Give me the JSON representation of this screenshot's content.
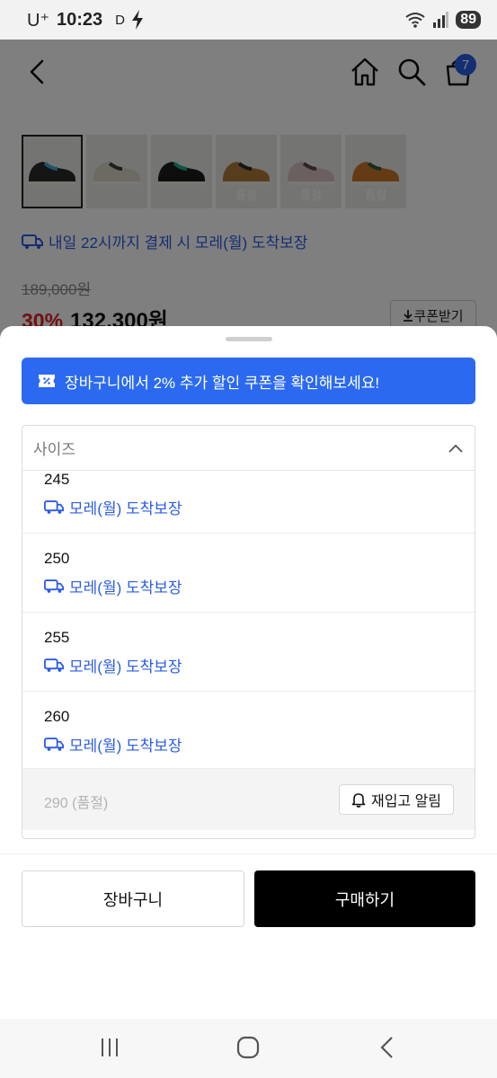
{
  "status_bar": {
    "carrier": "U⁺",
    "time": "10:23",
    "indicator": "D",
    "battery": "89"
  },
  "header": {
    "cart_count": "7"
  },
  "product": {
    "thumbnails": [
      {
        "color": "#2a2a2a",
        "accent": "#3aa6d6",
        "soldout": ""
      },
      {
        "color": "#d9d6c6",
        "accent": "#3a3a3a",
        "soldout": ""
      },
      {
        "color": "#1c1c1c",
        "accent": "#1fa98a",
        "soldout": ""
      },
      {
        "color": "#b07a3a",
        "accent": "#2a2a2a",
        "soldout": "품절"
      },
      {
        "color": "#d7bfc0",
        "accent": "#5a4a4a",
        "soldout": "품절"
      },
      {
        "color": "#c9772b",
        "accent": "#2f5a3a",
        "soldout": "품절"
      }
    ],
    "delivery_text": "내일 22시까지 결제 시 모레(월) 도착보장",
    "original_price": "189,000원",
    "discount_rate": "30%",
    "sale_price": "132,300원",
    "coupon_label": "쿠폰받기"
  },
  "sheet": {
    "promo_text": "장바구니에서 2% 추가 할인 쿠폰을 확인해보세요!",
    "select_label": "사이즈",
    "options": [
      {
        "size": "245",
        "delivery": "모레(월) 도착보장"
      },
      {
        "size": "250",
        "delivery": "모레(월) 도착보장"
      },
      {
        "size": "255",
        "delivery": "모레(월) 도착보장"
      },
      {
        "size": "260",
        "delivery": "모레(월) 도착보장"
      }
    ],
    "soldout_option": {
      "label": "290 (품절)",
      "restock_label": "재입고 알림"
    },
    "cart_button": "장바구니",
    "buy_button": "구매하기"
  },
  "colors": {
    "accent_blue": "#2b5ce6",
    "promo_blue": "#2b6af0",
    "discount_red": "#e02020"
  },
  "icons": [
    "back-icon",
    "home-icon",
    "search-icon",
    "cart-icon",
    "delivery-truck-icon",
    "coupon-icon",
    "chevron-up-icon",
    "bell-icon",
    "download-icon"
  ]
}
